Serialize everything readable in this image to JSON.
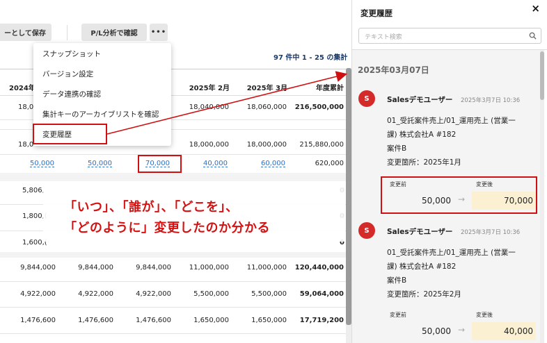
{
  "toolbar": {
    "save_label": "ーとして保存",
    "pl_label": "P/L分析で確認",
    "more_label": "•••"
  },
  "result_count": "97 件中 1 - 25 の集計",
  "table": {
    "headers": [
      "2024年",
      "2025年 2月",
      "2025年 3月",
      "年度累計"
    ],
    "rows": [
      [
        "18,0",
        "18,040,000",
        "18,060,000",
        "216,500,000"
      ],
      [
        "18,0",
        "18,000,000",
        "18,000,000",
        "215,880,000"
      ],
      [
        "50,000",
        "50,000",
        "70,000",
        "40,000",
        "60,000",
        "620,000"
      ],
      [
        "5,806,"
      ],
      [
        "1,800,("
      ],
      [
        "1,600,("
      ],
      [
        "9,844,000",
        "9,844,000",
        "9,844,000",
        "11,000,000",
        "11,000,000",
        "120,440,000"
      ],
      [
        "4,922,000",
        "4,922,000",
        "4,922,000",
        "5,500,000",
        "5,500,000",
        "59,064,000"
      ],
      [
        "1,476,600",
        "1,476,600",
        "1,476,600",
        "1,650,000",
        "1,650,000",
        "17,719,200"
      ]
    ]
  },
  "menu": {
    "items": [
      "スナップショット",
      "バージョン設定",
      "データ連携の確認",
      "集計キーのアーカイブリストを確認",
      "変更履歴"
    ]
  },
  "annotation": {
    "line1": "「いつ」、「誰が」、「どこを」、",
    "line2": "「どのように」変更したのか分かる"
  },
  "panel": {
    "title": "変更履歴",
    "close": "×",
    "search_placeholder": "テキスト検索",
    "date_heading": "2025年03月07日",
    "entries": [
      {
        "avatar": "S",
        "user": "Salesデモユーザー",
        "time": "2025年3月7日 10:36",
        "line1": "01_受託案件売上/01_運用売上 (営業一",
        "line2": "課) 株式会社A #182",
        "line3": "案件B",
        "line4": "変更箇所：2025年1月",
        "before_label": "変更前",
        "after_label": "変更後",
        "before": "50,000",
        "after": "70,000"
      },
      {
        "avatar": "S",
        "user": "Salesデモユーザー",
        "time": "2025年3月7日 10:36",
        "line1": "01_受託案件売上/01_運用売上 (営業一",
        "line2": "課) 株式会社A #182",
        "line3": "案件B",
        "line4": "変更箇所：2025年2月",
        "before_label": "変更前",
        "after_label": "変更後",
        "before": "50,000",
        "after": "40,000"
      }
    ]
  },
  "colors": {
    "highlight": "#d01010",
    "link": "#2a6fc9",
    "avatar": "#d42a2a",
    "after_bg": "#fbf1d2"
  }
}
